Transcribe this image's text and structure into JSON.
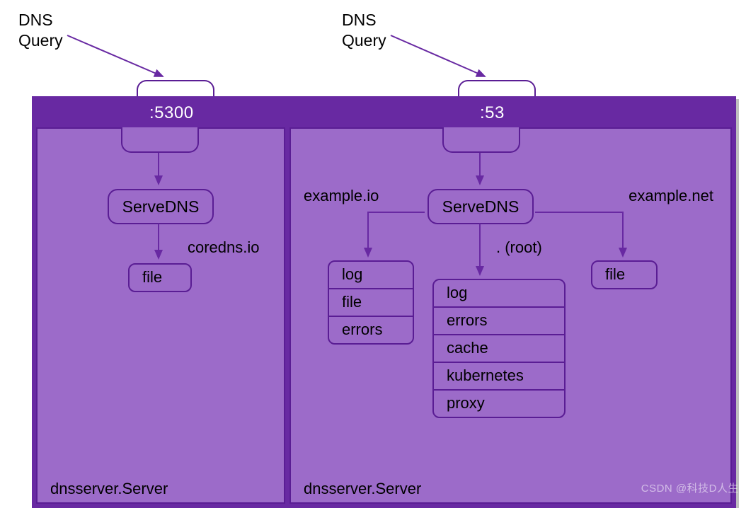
{
  "queries": {
    "left": "DNS\nQuery",
    "right": "DNS\nQuery"
  },
  "left": {
    "port": ":5300",
    "serve": "ServeDNS",
    "domain": "coredns.io",
    "plugins": [
      "file"
    ],
    "caption": "dnsserver.Server"
  },
  "right": {
    "port": ":53",
    "serve": "ServeDNS",
    "domain_left": "example.io",
    "domain_right": "example.net",
    "root_label": ". (root)",
    "plugins_left": [
      "log",
      "file",
      "errors"
    ],
    "plugins_root": [
      "log",
      "errors",
      "cache",
      "kubernetes",
      "proxy"
    ],
    "plugins_right": [
      "file"
    ],
    "caption": "dnsserver.Server"
  },
  "watermark": "CSDN @科技D人生"
}
